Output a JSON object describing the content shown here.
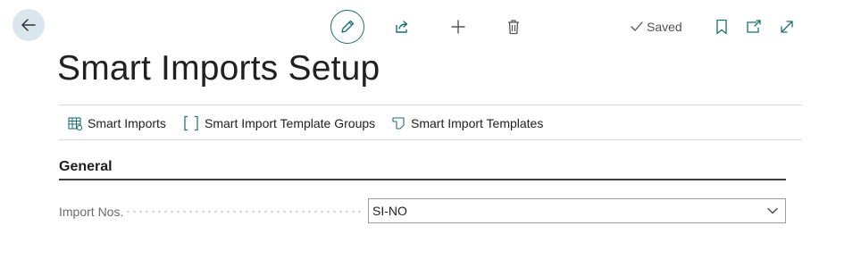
{
  "header": {
    "saved_label": "Saved"
  },
  "page": {
    "title": "Smart Imports Setup"
  },
  "actions": [
    {
      "label": "Smart Imports",
      "icon": "smart-imports-grid-icon"
    },
    {
      "label": "Smart Import Template Groups",
      "icon": "brackets-icon"
    },
    {
      "label": "Smart Import Templates",
      "icon": "template-page-icon"
    }
  ],
  "section": {
    "title": "General"
  },
  "fields": [
    {
      "label": "Import Nos.",
      "value": "SI-NO"
    }
  ],
  "colors": {
    "accent": "#1f6f73",
    "back_button_bg": "#dbe7ef",
    "divider": "#dadada"
  }
}
